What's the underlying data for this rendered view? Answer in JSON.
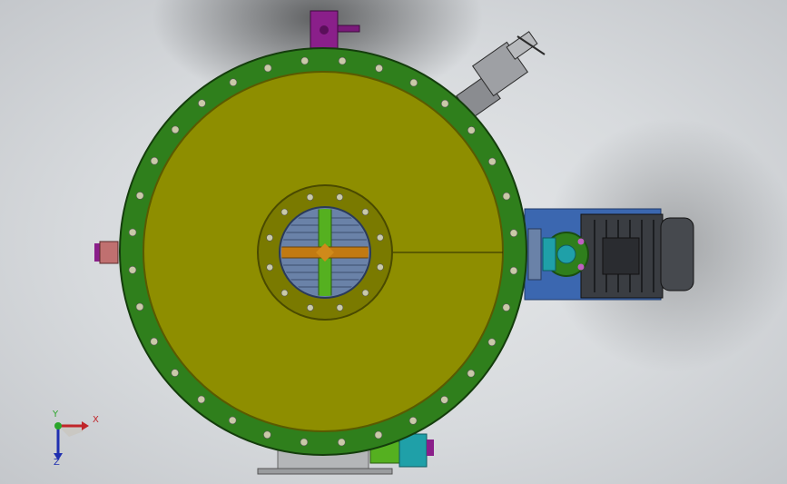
{
  "viewport": {
    "background_colors": [
      "#e6e8ea",
      "#c4c7cb"
    ]
  },
  "model": {
    "colors": {
      "flange": "#2f7f1c",
      "flange_edge": "#1a4d10",
      "face": "#8e8e00",
      "face_edge": "#5a5a00",
      "inner_flange": "#7a7a00",
      "port_blue": "#6a82a8",
      "vane_green": "#55b020",
      "vane_orange": "#c27a12",
      "motor_dark": "#3a3d42",
      "motor_plate": "#3b67b0",
      "valve_purple": "#8a1f8a",
      "cyan_fitting": "#1fa0a8",
      "bolt": "#c9c9a8"
    }
  },
  "triad": {
    "x_label": "X",
    "y_label": "Y",
    "z_label": "Z",
    "x_color": "#c0252a",
    "y_color": "#2aa52a",
    "z_color": "#1f2fb0"
  }
}
